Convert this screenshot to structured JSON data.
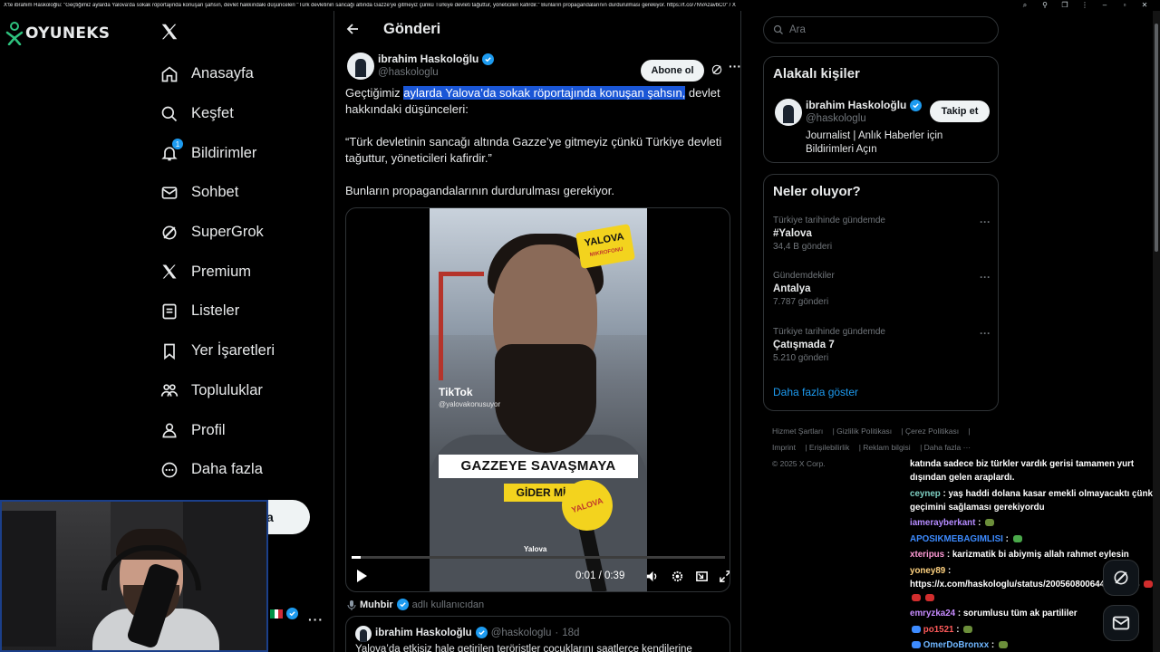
{
  "window": {
    "title": "X'te ibrahim Haskoloğlu: \"Geçtiğimiz aylarda Yalova'da sokak röportajında konuşan şahsın, devlet hakkındaki düşünceleri \"Türk devletinin sancağı altında Gazze'ye gitmeyiz çünkü Türkiye devleti tağuttur, yöneticileri kafirdir.\" Bunların propagandalarının durdurulması gerekiyor. https://t.co/7NVAzavbC0\" / X"
  },
  "brand": {
    "name": "OYUNEKS"
  },
  "nav": {
    "items": [
      {
        "label": "Anasayfa",
        "icon": "home-icon"
      },
      {
        "label": "Keşfet",
        "icon": "search-icon"
      },
      {
        "label": "Bildirimler",
        "icon": "bell-icon",
        "badge": "1"
      },
      {
        "label": "Sohbet",
        "icon": "mail-icon"
      },
      {
        "label": "SuperGrok",
        "icon": "grok-icon"
      },
      {
        "label": "Premium",
        "icon": "x-icon"
      },
      {
        "label": "Listeler",
        "icon": "list-icon"
      },
      {
        "label": "Yer İşaretleri",
        "icon": "bookmark-icon"
      },
      {
        "label": "Topluluklar",
        "icon": "people-icon"
      },
      {
        "label": "Profil",
        "icon": "user-icon"
      },
      {
        "label": "Daha fazla",
        "icon": "more-circle-icon"
      }
    ],
    "post_button_fragment": "a"
  },
  "main": {
    "header_title": "Gönderi",
    "author": {
      "name": "ibrahim Haskoloğlu",
      "handle": "@haskologlu"
    },
    "subscribe_label": "Abone ol",
    "text": {
      "p1_before": "Geçtiğimiz ",
      "p1_highlight": "aylarda Yalova’da sokak röportajında konuşan şahsın,",
      "p1_after": " devlet hakkındaki düşünceleri:",
      "p2": "“Türk devletinin sancağı altında Gazze’ye gitmeyiz çünkü Türkiye devleti tağuttur, yöneticileri kafirdir.”",
      "p3": "Bunların propagandalarının durdurulması gerekiyor."
    },
    "video": {
      "logo_text": "YALOVA",
      "logo_sub": "MIKROFONU",
      "tiktok_label": "TikTok",
      "tiktok_handle": "@yalovakonusuyor",
      "caption_1": "GAZZEYE SAVAŞMAYA",
      "caption_2": "GİDER Mİ",
      "mic_label": "YALOVA",
      "bottom_label": "Yalova",
      "time": "0:01 / 0:39",
      "progress": 0.024
    },
    "muhbir": {
      "name": "Muhbir",
      "suffix": "adlı kullanıcıdan"
    },
    "quote": {
      "name": "ibrahim Haskoloğlu",
      "handle": "@haskologlu",
      "date": "18d",
      "text": "Yalova’da etkisiz hale getirilen teröristler çocuklarını saatlerce kendilerine"
    }
  },
  "sidebar": {
    "search_placeholder": "Ara",
    "related": {
      "title": "Alakalı kişiler",
      "name": "ibrahim Haskoloğlu",
      "handle": "@haskologlu",
      "bio": "Journalist | Anlık Haberler için Bildirimleri Açın",
      "follow_label": "Takip et"
    },
    "trends": {
      "title": "Neler oluyor?",
      "items": [
        {
          "context": "Türkiye tarihinde gündemde",
          "name": "#Yalova",
          "count": "34,4 B gönderi"
        },
        {
          "context": "Gündemdekiler",
          "name": "Antalya",
          "count": "7.787 gönderi"
        },
        {
          "context": "Türkiye tarihinde gündemde",
          "name": "Çatışmada 7",
          "count": "5.210 gönderi"
        }
      ],
      "show_more": "Daha fazla göster"
    },
    "footer": {
      "links": [
        "Hizmet Şartları",
        "Gizlilik Politikası",
        "Çerez Politikası",
        "Imprint",
        "Erişilebilirlik",
        "Reklam bilgisi",
        "Daha fazla ···"
      ],
      "copyright": "© 2025 X Corp."
    }
  },
  "chat": [
    {
      "user": "",
      "text": "katında sadece biz türkler vardık gerisi tamamen yurt dışından gelen araplardı.",
      "color": "#ffffff"
    },
    {
      "user": "ceynep",
      "text": "yaş haddi dolana kasar emekli olmayacaktı çünkü geçimini sağlaması gerekiyordu",
      "color": "#7fd1c4"
    },
    {
      "user": "iamerayberkant",
      "text": "",
      "color": "#b58bff"
    },
    {
      "user": "APOSIKMEBAGIMLISI",
      "text": "",
      "color": "#3d8bff"
    },
    {
      "user": "xteripus",
      "text": "karizmatik bi abiymiş allah rahmet eylesin",
      "color": "#ff9ad5"
    },
    {
      "user": "yoney89",
      "text": "https://x.com/haskologlu/status/2005608006449570714",
      "color": "#ffd27f"
    },
    {
      "user": "emryzka24",
      "text": "sorumlusu tüm ak partililer",
      "color": "#c78bff"
    },
    {
      "user": "po1521",
      "text": "",
      "color": "#ff5a5a"
    },
    {
      "user": "OmerDoBronxx",
      "text": "",
      "color": "#6fb6ff"
    }
  ],
  "colors": {
    "accent": "#1d9bf0",
    "highlight": "#1a56d6",
    "border": "#2f3336",
    "muted": "#71767b"
  }
}
